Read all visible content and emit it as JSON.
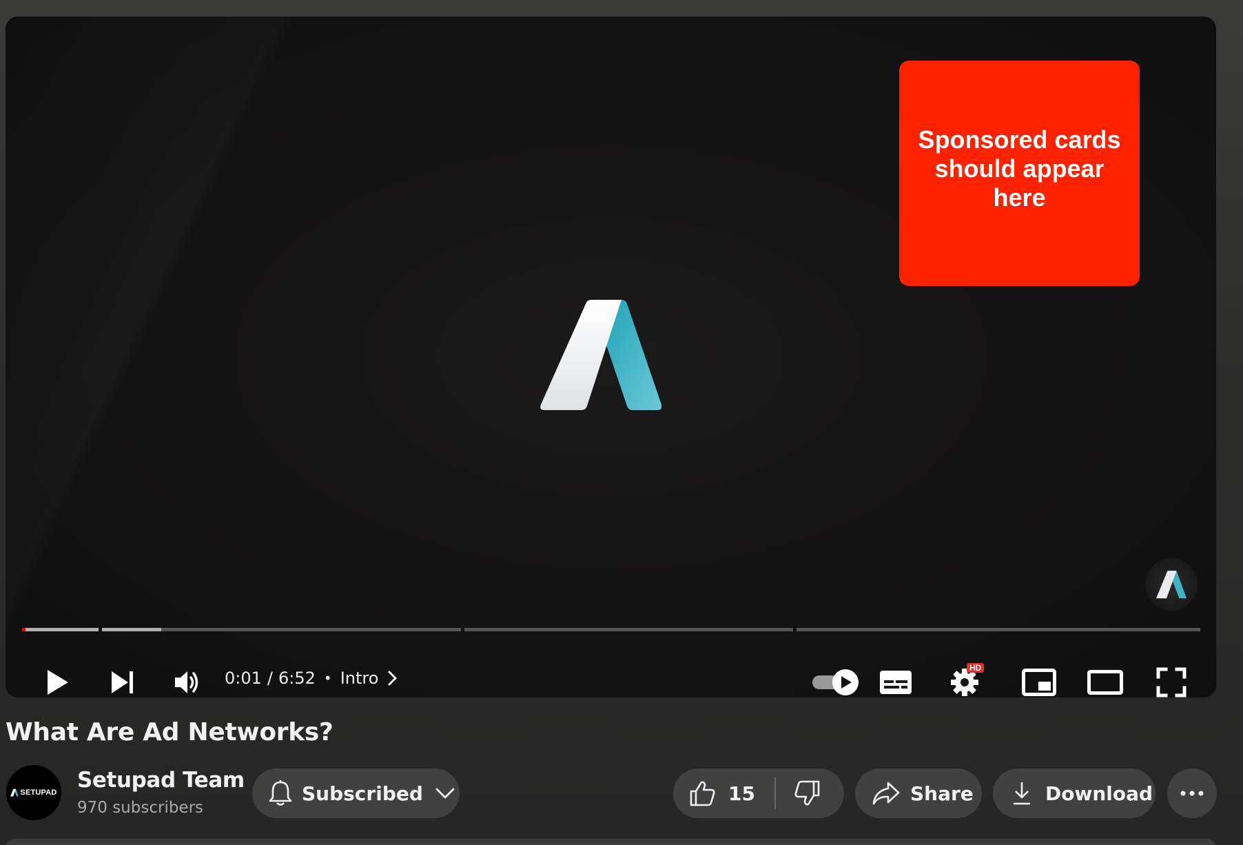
{
  "player": {
    "sponsor_text": "Sponsored cards should appear here",
    "time_current": "0:01",
    "time_separator": "/",
    "time_total": "6:52",
    "chapter_dot": "•",
    "chapter_name": "Intro",
    "hd_badge": "HD",
    "progress_played_fraction": 0.0
  },
  "video": {
    "title": "What Are Ad Networks?"
  },
  "channel": {
    "name": "Setupad Team",
    "subscribers": "970 subscribers",
    "avatar_text": "SETUPAD"
  },
  "actions": {
    "subscribed_label": "Subscribed",
    "like_count": "15",
    "share_label": "Share",
    "download_label": "Download"
  },
  "colors": {
    "sponsor_card": "#ff2200",
    "progress_played": "#ff0000",
    "logo_teal": "#3fb3c6",
    "logo_white": "#eef0f2"
  },
  "icons": [
    "play-icon",
    "next-icon",
    "volume-icon",
    "chevron-right-icon",
    "autoplay-toggle-icon",
    "subtitles-icon",
    "settings-icon",
    "miniplayer-icon",
    "theater-mode-icon",
    "fullscreen-icon",
    "bell-icon",
    "chevron-down-icon",
    "thumbs-up-icon",
    "thumbs-down-icon",
    "share-arrow-icon",
    "download-icon",
    "more-icon"
  ]
}
